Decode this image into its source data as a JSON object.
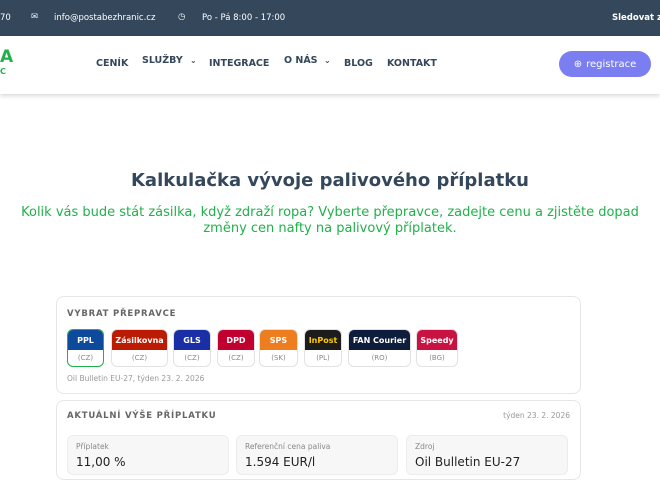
{
  "topbar": {
    "phone": "70",
    "email": "info@postabezhranic.cz",
    "hours": "Po - Pá 8:00 - 17:00",
    "track": "Sledovat zá"
  },
  "nav": {
    "logo_top": "A",
    "logo_bottom": "C",
    "items": [
      "CENÍK",
      "SLUŽBY",
      "INTEGRACE",
      "O NÁS",
      "BLOG",
      "KONTAKT"
    ],
    "register": "registrace"
  },
  "title": "Kalkulačka vývoje palivového příplatku",
  "subtitle": "Kolik vás bude stát zásilka, když zdraží ropa? Vyberte přepravce, zadejte cenu a zjistěte dopad změny cen nafty na palivový příplatek.",
  "carriers": {
    "label": "VYBRAT PŘEPRAVCE",
    "items": [
      {
        "name": "PPL",
        "country": "(CZ)",
        "color": "#0d4a9b",
        "text": "#fff",
        "selected": true
      },
      {
        "name": "Zásilkovna",
        "country": "(CZ)",
        "color": "#ba1b02",
        "text": "#fff"
      },
      {
        "name": "GLS",
        "country": "(CZ)",
        "color": "#1a2fa5",
        "text": "#fff"
      },
      {
        "name": "DPD",
        "country": "(CZ)",
        "color": "#c1002f",
        "text": "#fff"
      },
      {
        "name": "SPS",
        "country": "(SK)",
        "color": "#ee7d1f",
        "text": "#fff"
      },
      {
        "name": "InPost",
        "country": "(PL)",
        "color": "#1c1c1c",
        "text": "#ffcb04"
      },
      {
        "name": "FAN Courier",
        "country": "(RO)",
        "color": "#0f1d3d",
        "text": "#fff"
      },
      {
        "name": "Speedy",
        "country": "(BG)",
        "color": "#c81342",
        "text": "#fff"
      }
    ],
    "note": "Oil Bulletin EU-27, týden 23. 2. 2026"
  },
  "current": {
    "label": "AKTUÁLNÍ VÝŠE PŘÍPLATKU",
    "week": "týden 23. 2. 2026",
    "boxes": [
      {
        "key": "Příplatek",
        "value": "11,00 %"
      },
      {
        "key": "Referenční cena paliva",
        "value": "1.594 EUR/l"
      },
      {
        "key": "Zdroj",
        "value": "Oil Bulletin EU-27"
      }
    ]
  }
}
